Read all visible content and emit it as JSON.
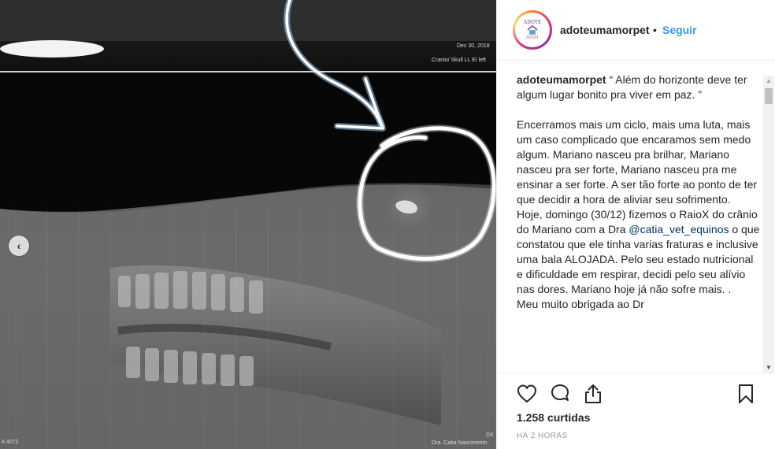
{
  "post_image": {
    "xray_date": "Dec 30, 2018",
    "xray_label": "Cranio/ Skull LL E/ left",
    "xray_footer_left": "8 4072",
    "xray_footer_right_top": "DX",
    "xray_footer_right": "Dra. Catia Nascimento",
    "prev_icon_glyph": "‹"
  },
  "header": {
    "avatar_top_text": "ADOTE",
    "avatar_bottom_text": "Amor",
    "username": "adoteumamorpet",
    "separator": "•",
    "follow_label": "Seguir"
  },
  "caption": {
    "author": "adoteumamorpet",
    "intro": " “ Além do horizonte deve ter algum lugar bonito pra viver em paz. ”",
    "para1": "Encerramos mais um ciclo, mais uma luta, mais um caso complicado que encaramos sem medo algum. Mariano nasceu pra brilhar, Mariano nasceu pra ser forte, Mariano nasceu pra me ensinar a ser forte. A ser tão forte ao ponto de ter que decidir a hora de aliviar seu sofrimento.",
    "para2_before": "Hoje, domingo (30/12) fizemos o RaioX do crânio do Mariano com a Dra ",
    "mention": "@catia_vet_equinos",
    "para2_after": " o que constatou que ele tinha varias fraturas e inclusive uma bala ALOJADA. Pelo seu estado nutricional e dificuldade em respirar, decidi pelo seu alívio nas dores. Mariano hoje já não sofre mais. .",
    "para3": "Meu muito obrigada ao Dr"
  },
  "actions": {
    "like_icon": "heart-icon",
    "comment_icon": "comment-icon",
    "share_icon": "share-icon",
    "save_icon": "bookmark-icon"
  },
  "likes_text": "1.258 curtidas",
  "timestamp": "HÁ 2 HORAS"
}
